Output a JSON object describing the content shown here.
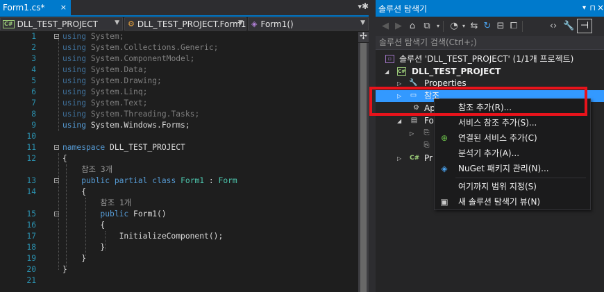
{
  "editor": {
    "tab": {
      "title": "Form1.cs*",
      "close": "×",
      "pin_icon": "▾",
      "settings_icon": "✱"
    },
    "nav": {
      "project": "DLL_TEST_PROJECT",
      "class": "DLL_TEST_PROJECT.Form1",
      "member": "Form1()",
      "cs_badge": "C#"
    },
    "split_button": "✢",
    "lines": [
      {
        "n": "1",
        "segs": [
          [
            "kw",
            "using"
          ],
          [
            "t",
            " System;"
          ]
        ],
        "fold": true
      },
      {
        "n": "2",
        "segs": [
          [
            "kw",
            "using"
          ],
          [
            "t",
            " System.Collections.Generic;"
          ]
        ]
      },
      {
        "n": "3",
        "segs": [
          [
            "kw",
            "using"
          ],
          [
            "t",
            " System.ComponentModel;"
          ]
        ]
      },
      {
        "n": "4",
        "segs": [
          [
            "kw",
            "using"
          ],
          [
            "t",
            " System.Data;"
          ]
        ]
      },
      {
        "n": "5",
        "segs": [
          [
            "kw",
            "using"
          ],
          [
            "t",
            " System.Drawing;"
          ]
        ]
      },
      {
        "n": "6",
        "segs": [
          [
            "kw",
            "using"
          ],
          [
            "t",
            " System.Linq;"
          ]
        ]
      },
      {
        "n": "7",
        "segs": [
          [
            "kw",
            "using"
          ],
          [
            "t",
            " System.Text;"
          ]
        ]
      },
      {
        "n": "8",
        "segs": [
          [
            "kw",
            "using"
          ],
          [
            "t",
            " System.Threading.Tasks;"
          ]
        ]
      },
      {
        "n": "9",
        "segs": [
          [
            "kw",
            "using"
          ],
          [
            "t",
            " System.Windows.Forms;"
          ]
        ]
      },
      {
        "n": "10",
        "segs": []
      },
      {
        "n": "11",
        "segs": [
          [
            "kw",
            "namespace"
          ],
          [
            "t",
            " DLL_TEST_PROJECT"
          ]
        ],
        "fold": true
      },
      {
        "n": "12",
        "segs": [
          [
            "t",
            "{"
          ]
        ]
      },
      {
        "n": "",
        "segs": [
          [
            "g",
            "    참조 3개"
          ]
        ]
      },
      {
        "n": "13",
        "segs": [
          [
            "t",
            "    "
          ],
          [
            "kw",
            "public"
          ],
          [
            "t",
            " "
          ],
          [
            "kw",
            "partial"
          ],
          [
            "t",
            " "
          ],
          [
            "kw",
            "class"
          ],
          [
            "t",
            " "
          ],
          [
            "ty",
            "Form1"
          ],
          [
            "t",
            " : "
          ],
          [
            "ty",
            "Form"
          ]
        ],
        "fold": true
      },
      {
        "n": "14",
        "segs": [
          [
            "t",
            "    {"
          ]
        ]
      },
      {
        "n": "",
        "segs": [
          [
            "g",
            "        참조 1개"
          ]
        ]
      },
      {
        "n": "15",
        "segs": [
          [
            "t",
            "        "
          ],
          [
            "kw",
            "public"
          ],
          [
            "t",
            " Form1()"
          ]
        ],
        "fold": true
      },
      {
        "n": "16",
        "segs": [
          [
            "t",
            "        {"
          ]
        ]
      },
      {
        "n": "17",
        "segs": [
          [
            "t",
            "            InitializeComponent();"
          ]
        ]
      },
      {
        "n": "18",
        "segs": [
          [
            "t",
            "        }"
          ]
        ]
      },
      {
        "n": "19",
        "segs": [
          [
            "t",
            "    }"
          ]
        ]
      },
      {
        "n": "20",
        "segs": [
          [
            "t",
            "}"
          ]
        ]
      },
      {
        "n": "21",
        "segs": []
      }
    ]
  },
  "solution_explorer": {
    "title": "솔루션 탐색기",
    "title_icons": [
      "▾",
      "⊓",
      "×"
    ],
    "search_placeholder": "솔루션 탐색기 검색(Ctrl+;)",
    "tree": {
      "solution": "솔루션 'DLL_TEST_PROJECT' (1/1개 프로젝트)",
      "project": "DLL_TEST_PROJECT",
      "properties": "Properties",
      "references": "참조",
      "app_config": "Ap",
      "form": "Fo",
      "program": "Pr"
    }
  },
  "context_menu": {
    "items": [
      {
        "label": "참조 추가(R)...",
        "icon": ""
      },
      {
        "label": "서비스 참조 추가(S)...",
        "icon": ""
      },
      {
        "label": "연결된 서비스 추가(C)",
        "icon": "⊕"
      },
      {
        "label": "분석기 추가(A)...",
        "icon": ""
      },
      {
        "label": "NuGet 패키지 관리(N)...",
        "icon": "◈"
      },
      {
        "label": "여기까지 범위 지정(S)",
        "icon": ""
      },
      {
        "label": "새 솔루션 탐색기 뷰(N)",
        "icon": "▣"
      }
    ]
  },
  "colors": {
    "accent": "#007acc",
    "selection": "#3399ff",
    "highlight_box": "#e8131b",
    "keyword": "#569cd6",
    "type": "#4ec9b0",
    "line_number": "#2b91af"
  }
}
